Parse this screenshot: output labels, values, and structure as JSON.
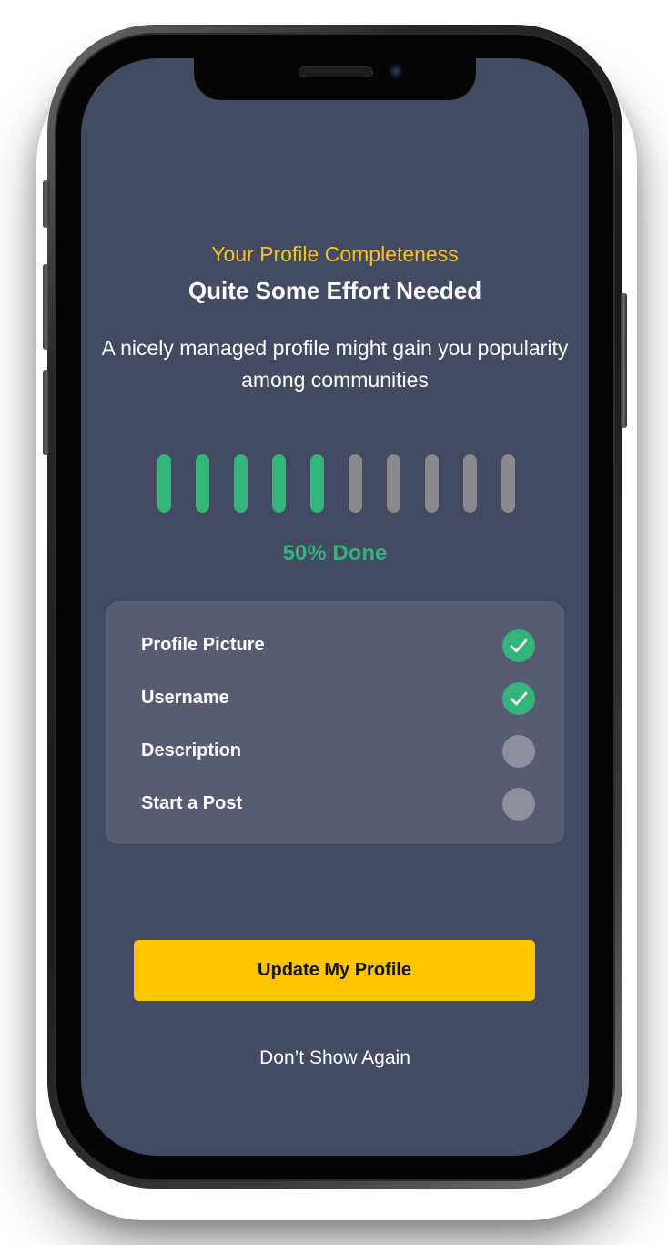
{
  "header": {
    "subtitle": "Your Profile Completeness",
    "title": "Quite Some Effort Needed",
    "description": "A nicely managed profile might gain you popularity among communities"
  },
  "progress": {
    "completed_fraction": 0.5,
    "total_segments": 10,
    "completed_segments": 5,
    "label": "50% Done",
    "active_color": "#34b37a",
    "inactive_color": "#8a8a8c"
  },
  "checklist": {
    "items": [
      {
        "label": "Profile Picture",
        "done": true
      },
      {
        "label": "Username",
        "done": true
      },
      {
        "label": "Description",
        "done": false
      },
      {
        "label": "Start a Post",
        "done": false
      }
    ],
    "done_color": "#34b37a",
    "pending_color": "#8e8f9d",
    "check_icon": "check-icon"
  },
  "actions": {
    "primary_label": "Update My Profile",
    "secondary_label": "Don’t Show Again"
  },
  "colors": {
    "screen_background": "#434a61",
    "card_background": "#575c72",
    "accent_yellow": "#fdc400",
    "subtitle_yellow": "#f5c518"
  }
}
